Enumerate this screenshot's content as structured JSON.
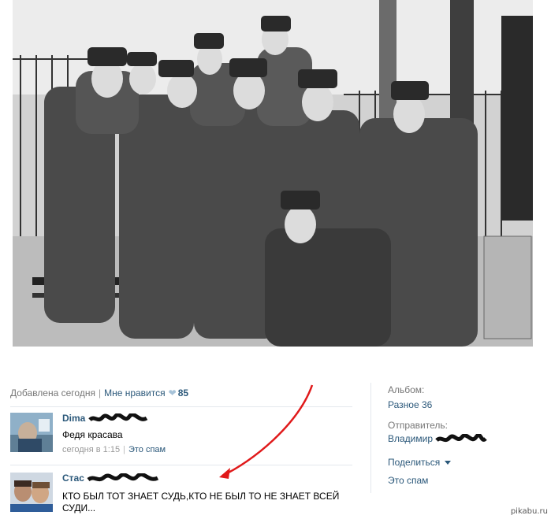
{
  "photo": {
    "description_icon": "group-photo"
  },
  "meta": {
    "added": "Добавлена сегодня",
    "like_label": "Мне нравится",
    "like_count": "85"
  },
  "comments": [
    {
      "author": "Dima",
      "text": "Федя красава",
      "time": "сегодня в 1:15",
      "spam": "Это спам"
    },
    {
      "author": "Стас",
      "text": "КТО БЫЛ ТОТ ЗНАЕТ СУДЬ,КТО НЕ БЫЛ ТО НЕ ЗНАЕТ ВСЕЙ СУДИ..."
    }
  ],
  "sidebar": {
    "album_label": "Альбом:",
    "album_name": "Разное 36",
    "sender_label": "Отправитель:",
    "sender_name": "Владимир",
    "share": "Поделиться",
    "spam": "Это спам"
  },
  "colors": {
    "link": "#2b587a",
    "muted": "#777777",
    "arrow": "#e0191a"
  },
  "watermark": "pikabu.ru"
}
